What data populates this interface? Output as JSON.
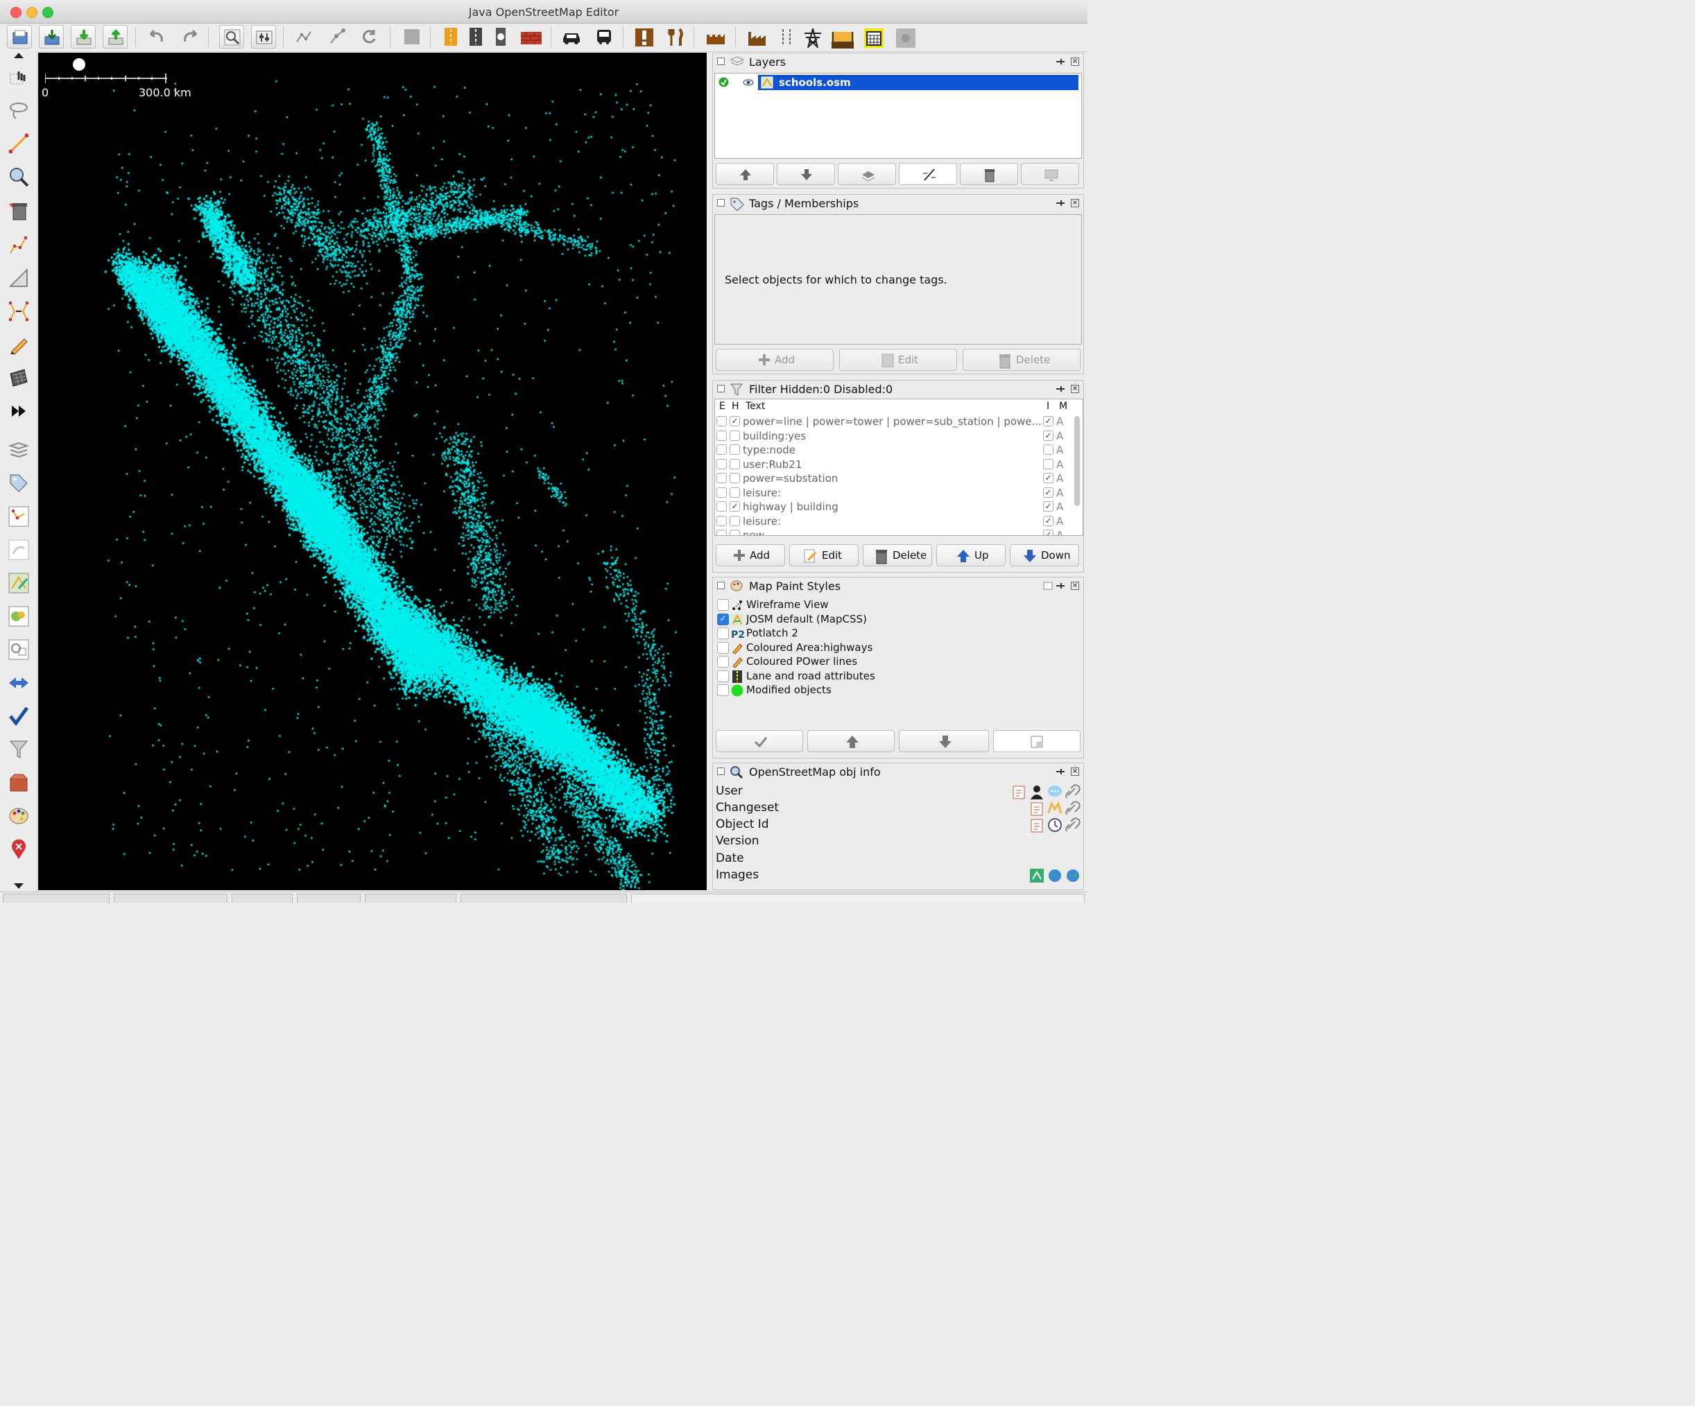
{
  "window": {
    "title": "Java OpenStreetMap Editor"
  },
  "toolbar": {
    "buttons": [
      "open-file",
      "download-data",
      "download-osm",
      "upload",
      "undo",
      "redo",
      "zoom-to-data",
      "preferences",
      "select-mode",
      "draw-mode",
      "refresh",
      "presets-gray",
      "highway",
      "road",
      "roundabout",
      "barrier",
      "car",
      "bus",
      "warning",
      "restaurant",
      "castle",
      "factory",
      "fence",
      "power-tower",
      "bridge",
      "calendar",
      "misc-gray"
    ]
  },
  "map": {
    "scale_start": "0",
    "scale_end": "300.0 km",
    "point_color": "#00f0f0",
    "background": "#000000"
  },
  "layers": {
    "title": "Layers",
    "items": [
      {
        "name": "schools.osm",
        "visible": true,
        "active": true
      }
    ]
  },
  "tags": {
    "title": "Tags / Memberships",
    "empty_message": "Select objects for which to change tags.",
    "add_label": "Add",
    "edit_label": "Edit",
    "delete_label": "Delete"
  },
  "filter": {
    "title": "Filter Hidden:0 Disabled:0",
    "col_e": "E",
    "col_h": "H",
    "col_text": "Text",
    "col_i": "I",
    "col_m": "M",
    "rows": [
      {
        "text": "power=line | power=tower | power=sub_station | powe...",
        "e": false,
        "h": true,
        "i": true,
        "m": "A"
      },
      {
        "text": "building:yes",
        "e": false,
        "h": false,
        "i": true,
        "m": "A"
      },
      {
        "text": " type:node",
        "e": false,
        "h": false,
        "i": false,
        "m": "A"
      },
      {
        "text": "user:Rub21",
        "e": false,
        "h": false,
        "i": false,
        "m": "A"
      },
      {
        "text": "power=substation",
        "e": false,
        "h": false,
        "i": true,
        "m": "A"
      },
      {
        "text": "leisure:",
        "e": false,
        "h": false,
        "i": true,
        "m": "A"
      },
      {
        "text": "highway | building",
        "e": false,
        "h": true,
        "i": true,
        "m": "A"
      },
      {
        "text": "leisure:",
        "e": false,
        "h": false,
        "i": true,
        "m": "A"
      },
      {
        "text": " new",
        "e": false,
        "h": false,
        "i": true,
        "m": "A"
      }
    ],
    "add_label": "Add",
    "edit_label": "Edit",
    "delete_label": "Delete",
    "up_label": "Up",
    "down_label": "Down"
  },
  "styles": {
    "title": "Map Paint Styles",
    "items": [
      {
        "label": "Wireframe View",
        "checked": false,
        "icon": "wireframe-icon"
      },
      {
        "label": "JOSM default (MapCSS)",
        "checked": true,
        "icon": "josm-icon"
      },
      {
        "label": "Potlatch 2",
        "checked": false,
        "icon": "p2-icon"
      },
      {
        "label": "Coloured Area:highways",
        "checked": false,
        "icon": "pencil-icon"
      },
      {
        "label": "Coloured POwer lines",
        "checked": false,
        "icon": "pencil-icon"
      },
      {
        "label": "Lane and road attributes",
        "checked": false,
        "icon": "road-icon"
      },
      {
        "label": "Modified objects",
        "checked": false,
        "icon": "green-dot-icon"
      }
    ]
  },
  "objinfo": {
    "title": "OpenStreetMap obj info",
    "rows": [
      "User",
      "Changeset",
      "Object Id",
      "Version",
      "Date",
      "Images"
    ]
  }
}
